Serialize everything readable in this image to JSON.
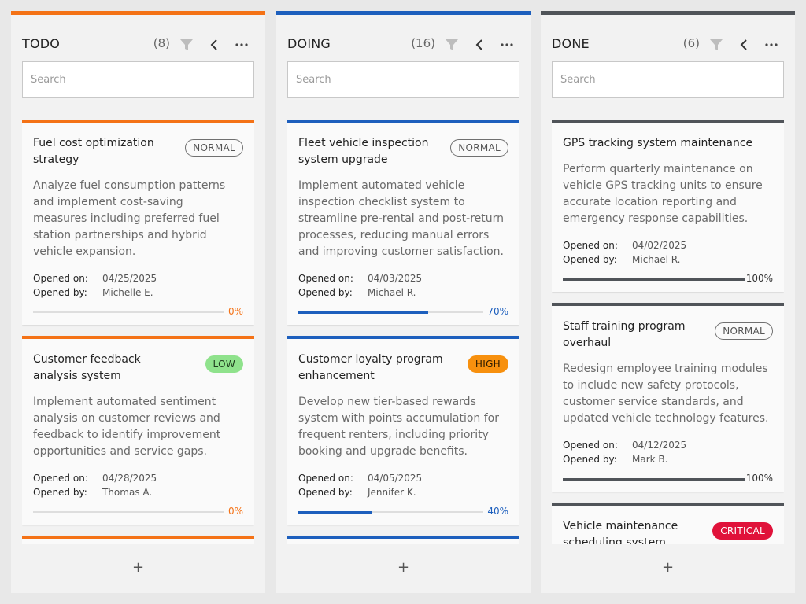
{
  "columns": [
    {
      "title": "TODO",
      "count": "(8)",
      "color": "#f47216",
      "search_placeholder": "Search",
      "add_label": "+",
      "cards": [
        {
          "title": "Fuel cost optimization strategy",
          "priority": "NORMAL",
          "description": "Analyze fuel consumption patterns and implement cost-saving measures including preferred fuel station partnerships and hybrid vehicle expansion.",
          "opened_on_label": "Opened on:",
          "opened_on": "04/25/2025",
          "opened_by_label": "Opened by:",
          "opened_by": "Michelle E.",
          "progress": 0,
          "progress_label": "0%"
        },
        {
          "title": "Customer feedback analysis system",
          "priority": "LOW",
          "description": "Implement automated sentiment analysis on customer reviews and feedback to identify improvement opportunities and service gaps.",
          "opened_on_label": "Opened on:",
          "opened_on": "04/28/2025",
          "opened_by_label": "Opened by:",
          "opened_by": "Thomas A.",
          "progress": 0,
          "progress_label": "0%"
        }
      ]
    },
    {
      "title": "DOING",
      "count": "(16)",
      "color": "#1d5fbd",
      "search_placeholder": "Search",
      "add_label": "+",
      "cards": [
        {
          "title": "Fleet vehicle inspection system upgrade",
          "priority": "NORMAL",
          "description": "Implement automated vehicle inspection checklist system to streamline pre-rental and post-return processes, reducing manual errors and improving customer satisfaction.",
          "opened_on_label": "Opened on:",
          "opened_on": "04/03/2025",
          "opened_by_label": "Opened by:",
          "opened_by": "Michael R.",
          "progress": 70,
          "progress_label": "70%"
        },
        {
          "title": "Customer loyalty program enhancement",
          "priority": "HIGH",
          "description": "Develop new tier-based rewards system with points accumulation for frequent renters, including priority booking and upgrade benefits.",
          "opened_on_label": "Opened on:",
          "opened_on": "04/05/2025",
          "opened_by_label": "Opened by:",
          "opened_by": "Jennifer K.",
          "progress": 40,
          "progress_label": "40%"
        }
      ]
    },
    {
      "title": "DONE",
      "count": "(6)",
      "color": "#505459",
      "search_placeholder": "Search",
      "add_label": "+",
      "cards": [
        {
          "title": "GPS tracking system maintenance",
          "priority": "",
          "description": "Perform quarterly maintenance on vehicle GPS tracking units to ensure accurate location reporting and emergency response capabilities.",
          "opened_on_label": "Opened on:",
          "opened_on": "04/02/2025",
          "opened_by_label": "Opened by:",
          "opened_by": "Michael R.",
          "progress": 100,
          "progress_label": "100%"
        },
        {
          "title": "Staff training program overhaul",
          "priority": "NORMAL",
          "description": "Redesign employee training modules to include new safety protocols, customer service standards, and updated vehicle technology features.",
          "opened_on_label": "Opened on:",
          "opened_on": "04/12/2025",
          "opened_by_label": "Opened by:",
          "opened_by": "Mark B.",
          "progress": 100,
          "progress_label": "100%"
        },
        {
          "title": "Vehicle maintenance scheduling system",
          "priority": "CRITICAL"
        }
      ]
    }
  ],
  "icons": {
    "filter": "filter-icon",
    "back": "chevron-left-icon",
    "more": "more-horizontal-icon",
    "add": "plus-icon"
  }
}
